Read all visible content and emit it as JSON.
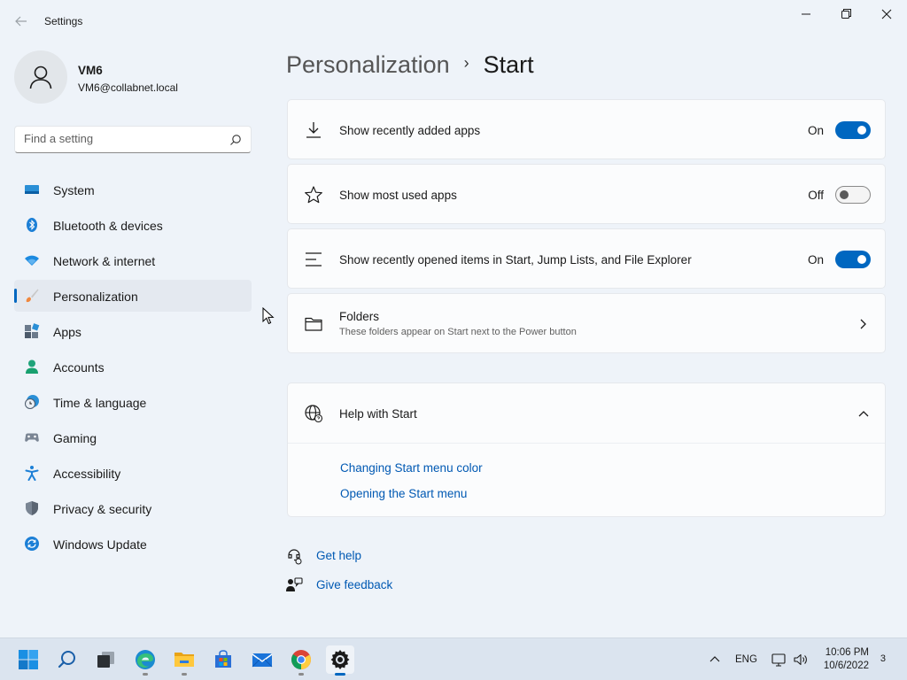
{
  "window": {
    "title": "Settings"
  },
  "profile": {
    "name": "VM6",
    "email": "VM6@collabnet.local"
  },
  "search": {
    "placeholder": "Find a setting"
  },
  "nav": {
    "items": [
      {
        "label": "System",
        "icon": "system-icon"
      },
      {
        "label": "Bluetooth & devices",
        "icon": "bluetooth-icon"
      },
      {
        "label": "Network & internet",
        "icon": "wifi-icon"
      },
      {
        "label": "Personalization",
        "icon": "brush-icon",
        "selected": true
      },
      {
        "label": "Apps",
        "icon": "apps-icon"
      },
      {
        "label": "Accounts",
        "icon": "accounts-icon"
      },
      {
        "label": "Time & language",
        "icon": "time-language-icon"
      },
      {
        "label": "Gaming",
        "icon": "gamepad-icon"
      },
      {
        "label": "Accessibility",
        "icon": "accessibility-icon"
      },
      {
        "label": "Privacy & security",
        "icon": "shield-icon"
      },
      {
        "label": "Windows Update",
        "icon": "update-icon"
      }
    ]
  },
  "breadcrumb": {
    "parent": "Personalization",
    "separator": "›",
    "current": "Start"
  },
  "settings": {
    "recently_added": {
      "label": "Show recently added apps",
      "state": "On",
      "on": true
    },
    "most_used": {
      "label": "Show most used apps",
      "state": "Off",
      "on": false
    },
    "recently_opened": {
      "label": "Show recently opened items in Start, Jump Lists, and File Explorer",
      "state": "On",
      "on": true
    },
    "folders": {
      "label": "Folders",
      "description": "These folders appear on Start next to the Power button"
    }
  },
  "help": {
    "title": "Help with Start",
    "links": [
      "Changing Start menu color",
      "Opening the Start menu"
    ]
  },
  "footer": {
    "get_help": "Get help",
    "give_feedback": "Give feedback"
  },
  "taskbar": {
    "apps": [
      "start-icon",
      "search-icon",
      "task-view-icon",
      "edge-icon",
      "file-explorer-icon",
      "store-icon",
      "mail-icon",
      "chrome-icon",
      "settings-icon"
    ],
    "language": "ENG",
    "time": "10:06 PM",
    "date": "10/6/2022",
    "notification_count": "3"
  },
  "colors": {
    "accent": "#0067c0",
    "background": "#eef3f9",
    "card": "#fbfcfd",
    "link": "#0059b3"
  }
}
